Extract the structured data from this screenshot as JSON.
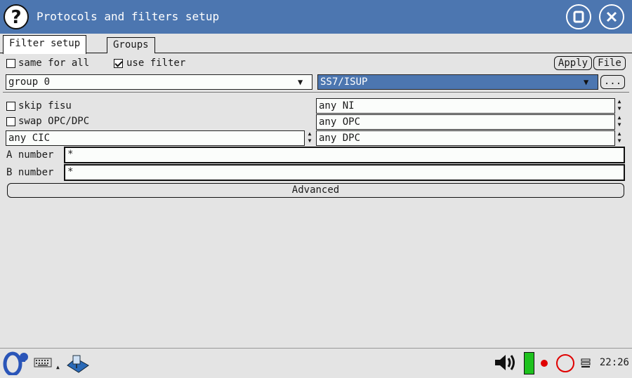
{
  "window": {
    "title": "Protocols and filters setup",
    "help_icon": "help-icon",
    "maximize_icon": "restore-icon",
    "close_icon": "close-icon"
  },
  "tabs": [
    {
      "label": "Filter setup",
      "active": true
    },
    {
      "label": "Groups",
      "active": false
    }
  ],
  "options": {
    "same_for_all_label": "same for all",
    "same_for_all_checked": false,
    "use_filter_label": "use filter",
    "use_filter_checked": true,
    "apply_label": "Apply",
    "file_label": "File"
  },
  "group_select": {
    "value": "group 0"
  },
  "protocol_select": {
    "value": "SS7/ISUP",
    "more_label": "..."
  },
  "filters": {
    "skip_fisu_label": "skip fisu",
    "skip_fisu_checked": false,
    "swap_label": "swap OPC/DPC",
    "swap_checked": false,
    "ni_value": "any NI",
    "opc_value": "any OPC",
    "cic_value": "any CIC",
    "dpc_value": "any DPC",
    "a_number_label": "A number",
    "a_number_value": "*",
    "b_number_label": "B number",
    "b_number_value": "*",
    "advanced_label": "Advanced"
  },
  "taskbar": {
    "clock": "22:26",
    "icons": [
      "start-menu-icon",
      "keyboard-icon",
      "network-icon",
      "speaker-icon",
      "battery-icon",
      "record-icon",
      "power-icon",
      "menu-icon"
    ],
    "battery_color": "#1ec21e",
    "record_color": "#e00000"
  },
  "colors": {
    "titlebar": "#4c76b0",
    "selected_field": "#4c76b0"
  }
}
